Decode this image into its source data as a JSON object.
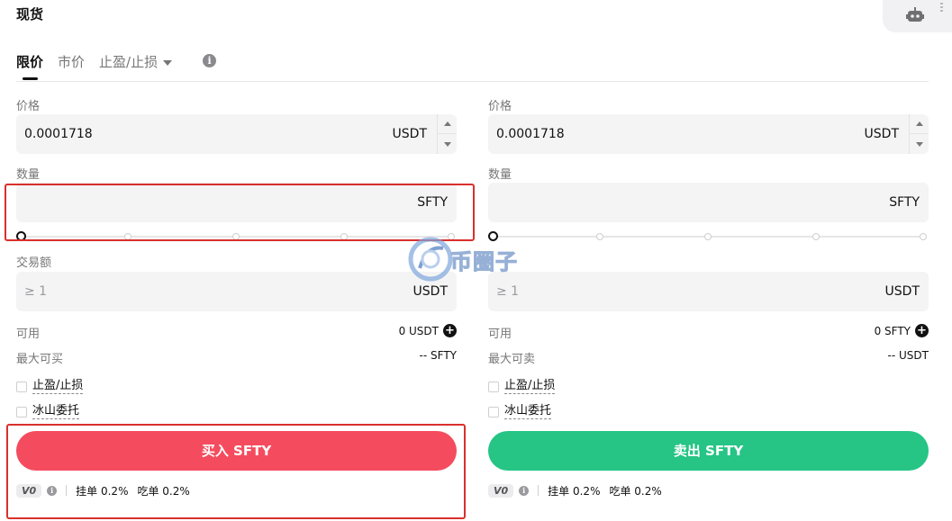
{
  "page": {
    "title": "现货"
  },
  "tabs": [
    {
      "label": "限价"
    },
    {
      "label": "市价"
    },
    {
      "label": "止盈/止损"
    }
  ],
  "buy": {
    "price_label": "价格",
    "price_value": "0.0001718",
    "price_unit": "USDT",
    "qty_label": "数量",
    "qty_unit": "SFTY",
    "amount_label": "交易额",
    "amount_placeholder": "≥ 1",
    "amount_unit": "USDT",
    "available_label": "可用",
    "available_value": "0 USDT",
    "max_label": "最大可买",
    "max_value": "-- SFTY",
    "opt_tpsl": "止盈/止损",
    "opt_iceberg": "冰山委托",
    "button": "买入 SFTY",
    "vip": "V0",
    "maker": "挂单 0.2%",
    "taker": "吃单 0.2%"
  },
  "sell": {
    "price_label": "价格",
    "price_value": "0.0001718",
    "price_unit": "USDT",
    "qty_label": "数量",
    "qty_unit": "SFTY",
    "amount_placeholder": "≥ 1",
    "amount_unit": "USDT",
    "available_label": "可用",
    "available_value": "0 SFTY",
    "max_label": "最大可卖",
    "max_value": "-- USDT",
    "opt_tpsl": "止盈/止损",
    "opt_iceberg": "冰山委托",
    "button": "卖出 SFTY",
    "vip": "V0",
    "maker": "挂单 0.2%",
    "taker": "吃单 0.2%"
  },
  "watermark": {
    "text": "币圈子"
  },
  "colors": {
    "buy": "#f44c5e",
    "sell": "#26c485",
    "highlight": "#d9302c"
  },
  "sliders": {
    "buy_percent": 0,
    "sell_percent": 0
  }
}
